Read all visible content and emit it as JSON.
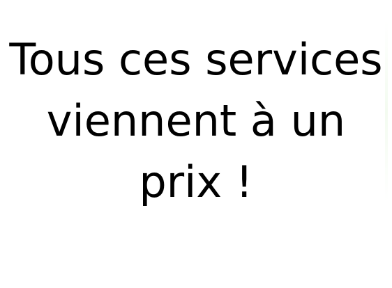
{
  "headline": {
    "line1": "Tous ces services",
    "line2": "viennent à un",
    "line3": "prix !"
  }
}
